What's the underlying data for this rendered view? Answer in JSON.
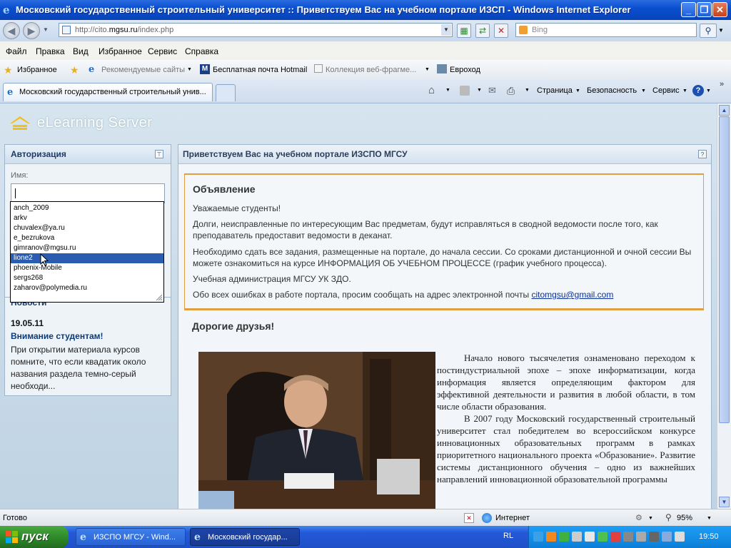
{
  "window": {
    "title": "Московский государственный строительный университет :: Приветствуем Вас на учебном портале ИЗСП - Windows Internet Explorer"
  },
  "address": {
    "url_prefix": "http://cito.",
    "url_domain": "mgsu.ru",
    "url_path": "/index.php"
  },
  "search": {
    "placeholder": "Bing"
  },
  "menu": [
    "Файл",
    "Правка",
    "Вид",
    "Избранное",
    "Сервис",
    "Справка"
  ],
  "favorites": {
    "button": "Избранное",
    "links": [
      "Рекомендуемые сайты",
      "Бесплатная почта Hotmail",
      "Коллекция веб-фрагме...",
      "Евроход"
    ]
  },
  "tabs": {
    "active": "Московский государственный строительный унив..."
  },
  "commandbar": {
    "page": "Страница",
    "safety": "Безопасность",
    "tools": "Сервис"
  },
  "site": {
    "logo": "eLearning Server"
  },
  "auth": {
    "title": "Авторизация",
    "name_label": "Имя:",
    "suggestions": [
      "anch_2009",
      "arkv",
      "chuvalex@ya.ru",
      "e_bezrukova",
      "gimranov@mgsu.ru",
      "lione2",
      "phoenix-Mobile",
      "sergs268",
      "zaharov@polymedia.ru"
    ],
    "selected_index": 5
  },
  "news": {
    "title": "Новости",
    "date": "19.05.11",
    "headline": "Внимание студентам!",
    "body": "При открытии материала курсов помните, что если квадатик около названия раздела темно-серый необходи..."
  },
  "main": {
    "title": "Приветствуем Вас на учебном портале ИЗСПО МГСУ",
    "announcement": {
      "heading": "Объявление",
      "p1": "Уважаемые студенты!",
      "p2": "Долги, неисправленные по интересующим Вас предметам, будут исправляться в сводной ведомости после того, как преподаватель предоставит ведомости в деканат.",
      "p3": "Необходимо сдать все задания, размещенные на портале, до начала сессии. Со сроками дистанционной и очной сессии Вы можете ознакомиться на курсе ИНФОРМАЦИЯ ОБ УЧЕБНОМ ПРОЦЕССЕ (график учебного процесса).",
      "p4": "Учебная администрация МГСУ УК ЗДО.",
      "p5": "Обо всех ошибках в работе портала, просим сообщать на адрес электронной почты ",
      "email": "citomgsu@gmail.com"
    },
    "friends": {
      "heading": "Дорогие друзья!",
      "p1": "Начало нового тысячелетия ознаменовано переходом к постиндустриальной эпохе – эпохе информатизации, когда информация является определяющим фактором для эффективной деятельности и развития в любой области, в том числе области образования.",
      "p2": "В 2007 году Московский государственный строительный университет  стал победителем во всероссийском конкурсе инновационных образовательных программ в рамках приоритетного национального проекта «Образование». Развитие системы дистанционного обучения – одно из важнейших направлений инновационной образовательной программы"
    }
  },
  "status": {
    "text": "Готово",
    "zone": "Интернет",
    "zoom": "95%"
  },
  "taskbar": {
    "start": "пуск",
    "tasks": [
      "ИЗСПО МГСУ - Wind...",
      "Московский государ..."
    ],
    "lang": "RL",
    "clock": "19:50"
  },
  "colors": {
    "accent": "#e0a040",
    "link": "#0a2f9a",
    "selection": "#2a5db0"
  }
}
